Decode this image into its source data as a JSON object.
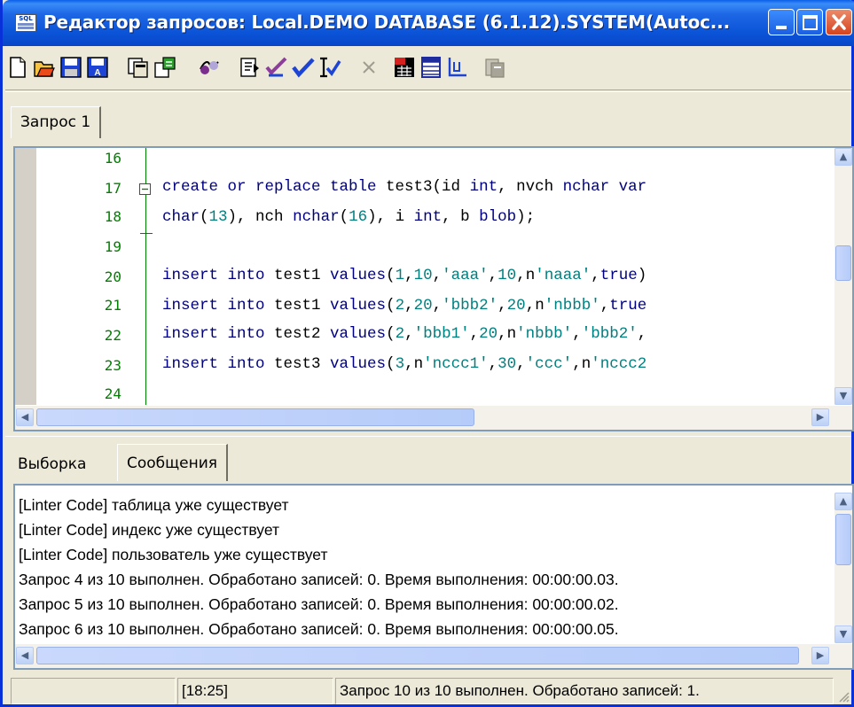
{
  "window": {
    "title": "Редактор запросов: Local.DEMO DATABASE (6.1.12).SYSTEM(Autoc...",
    "icon_label": "SQL",
    "controls": [
      "minimize-icon",
      "maximize-icon",
      "close-icon"
    ]
  },
  "toolbar": {
    "buttons": [
      "new-icon",
      "open-icon",
      "save-icon",
      "save-as-icon",
      "copy-query-icon",
      "import-icon",
      "connect-icon",
      "run-file-icon",
      "check-syntax-icon",
      "execute-icon",
      "execute-step-icon",
      "cancel-icon",
      "explain-icon",
      "results-grid-icon",
      "chart-icon",
      "export-icon"
    ]
  },
  "editor_tabs": {
    "active": "Запрос  1"
  },
  "editor": {
    "line_numbers": [
      "16",
      "17",
      "18",
      "19",
      "20",
      "21",
      "22",
      "23",
      "24"
    ],
    "lines": [
      "",
      "create or replace table test3(id int, nvch nchar var",
      "char(13), nch nchar(16), i int, b blob);",
      "",
      "insert into test1 values(1,10,'aaa',10,n'naaa',true)",
      "insert into test1 values(2,20,'bbb2',20,n'nbbb',true",
      "insert into test2 values(2,'bbb1',20,n'nbbb','bbb2',",
      "insert into test3 values(3,n'nccc1',30,'ccc',n'nccc2",
      ""
    ]
  },
  "result_tabs": {
    "tab1": "Выборка",
    "tab2": "Сообщения",
    "active": "Сообщения"
  },
  "messages": [
    "[Linter Code] таблица уже существует",
    "[Linter Code] индекс уже существует",
    "[Linter Code] пользователь уже существует",
    "Запрос 4 из 10 выполнен. Обработано записей: 0. Время выполнения: 00:00:00.03.",
    "Запрос 5 из 10 выполнен. Обработано записей: 0. Время выполнения: 00:00:00.02.",
    "Запрос 6 из 10 выполнен. Обработано записей: 0. Время выполнения: 00:00:00.05."
  ],
  "statusbar": {
    "panel1": "",
    "cursor": "[18:25]",
    "message": "Запрос 10 из 10 выполнен. Обработано записей: 1."
  },
  "colors": {
    "titlebar": "#0A5FE8",
    "line_numbers": "#007F00",
    "keywords": "#00007F",
    "strings": "#007F7F"
  }
}
